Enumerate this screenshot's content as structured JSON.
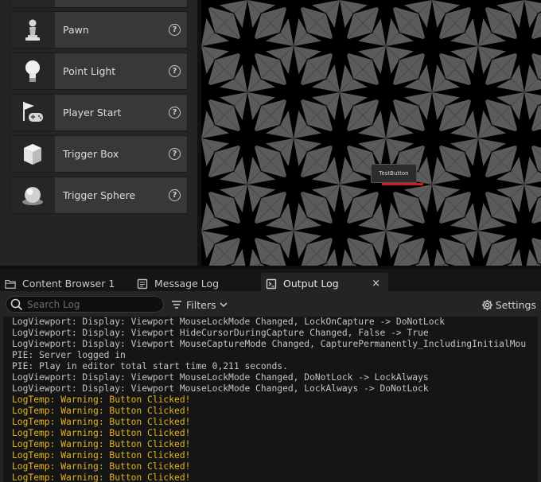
{
  "place_actors": {
    "items": [
      {
        "label": "",
        "icon": "cube-icon"
      },
      {
        "label": "Pawn",
        "icon": "pawn-icon"
      },
      {
        "label": "Point Light",
        "icon": "lightbulb-icon"
      },
      {
        "label": "Player Start",
        "icon": "flag-gamepad-icon"
      },
      {
        "label": "Trigger Box",
        "icon": "box-icon"
      },
      {
        "label": "Trigger Sphere",
        "icon": "sphere-icon"
      }
    ],
    "help_glyph": "?"
  },
  "viewport": {
    "test_button_label": "TestButton"
  },
  "tabs": [
    {
      "label": "Content Browser 1",
      "icon": "folder-icon",
      "active": false
    },
    {
      "label": "Message Log",
      "icon": "message-log-icon",
      "active": false
    },
    {
      "label": "Output Log",
      "icon": "output-log-icon",
      "active": true
    }
  ],
  "tab_close_glyph": "×",
  "toolbar": {
    "search_placeholder": "Search Log",
    "filters_label": "Filters",
    "settings_label": "Settings"
  },
  "log": {
    "lines": [
      {
        "text": "LogViewport: Display: Viewport MouseLockMode Changed, LockOnCapture -> DoNotLock",
        "level": "info"
      },
      {
        "text": "LogViewport: Display: Viewport HideCursorDuringCapture Changed, False -> True",
        "level": "info"
      },
      {
        "text": "LogViewport: Display: Viewport MouseCaptureMode Changed, CapturePermanently_IncludingInitialMou",
        "level": "info"
      },
      {
        "text": "PIE: Server logged in",
        "level": "info"
      },
      {
        "text": "PIE: Play in editor total start time 0,211 seconds.",
        "level": "info"
      },
      {
        "text": "LogViewport: Display: Viewport MouseLockMode Changed, DoNotLock -> LockAlways",
        "level": "info"
      },
      {
        "text": "LogViewport: Display: Viewport MouseLockMode Changed, LockAlways -> DoNotLock",
        "level": "info"
      },
      {
        "text": "LogTemp: Warning: Button Clicked!",
        "level": "warning"
      },
      {
        "text": "LogTemp: Warning: Button Clicked!",
        "level": "warning"
      },
      {
        "text": "LogTemp: Warning: Button Clicked!",
        "level": "warning"
      },
      {
        "text": "LogTemp: Warning: Button Clicked!",
        "level": "warning"
      },
      {
        "text": "LogTemp: Warning: Button Clicked!",
        "level": "warning"
      },
      {
        "text": "LogTemp: Warning: Button Clicked!",
        "level": "warning"
      },
      {
        "text": "LogTemp: Warning: Button Clicked!",
        "level": "warning"
      },
      {
        "text": "LogTemp: Warning: Button Clicked!",
        "level": "warning"
      }
    ]
  },
  "colors": {
    "log_info": "#c4c4c4",
    "log_warning": "#e6b422",
    "test_button_underline": "#d21b1b",
    "viewport_grey": "#5a5a5a"
  }
}
